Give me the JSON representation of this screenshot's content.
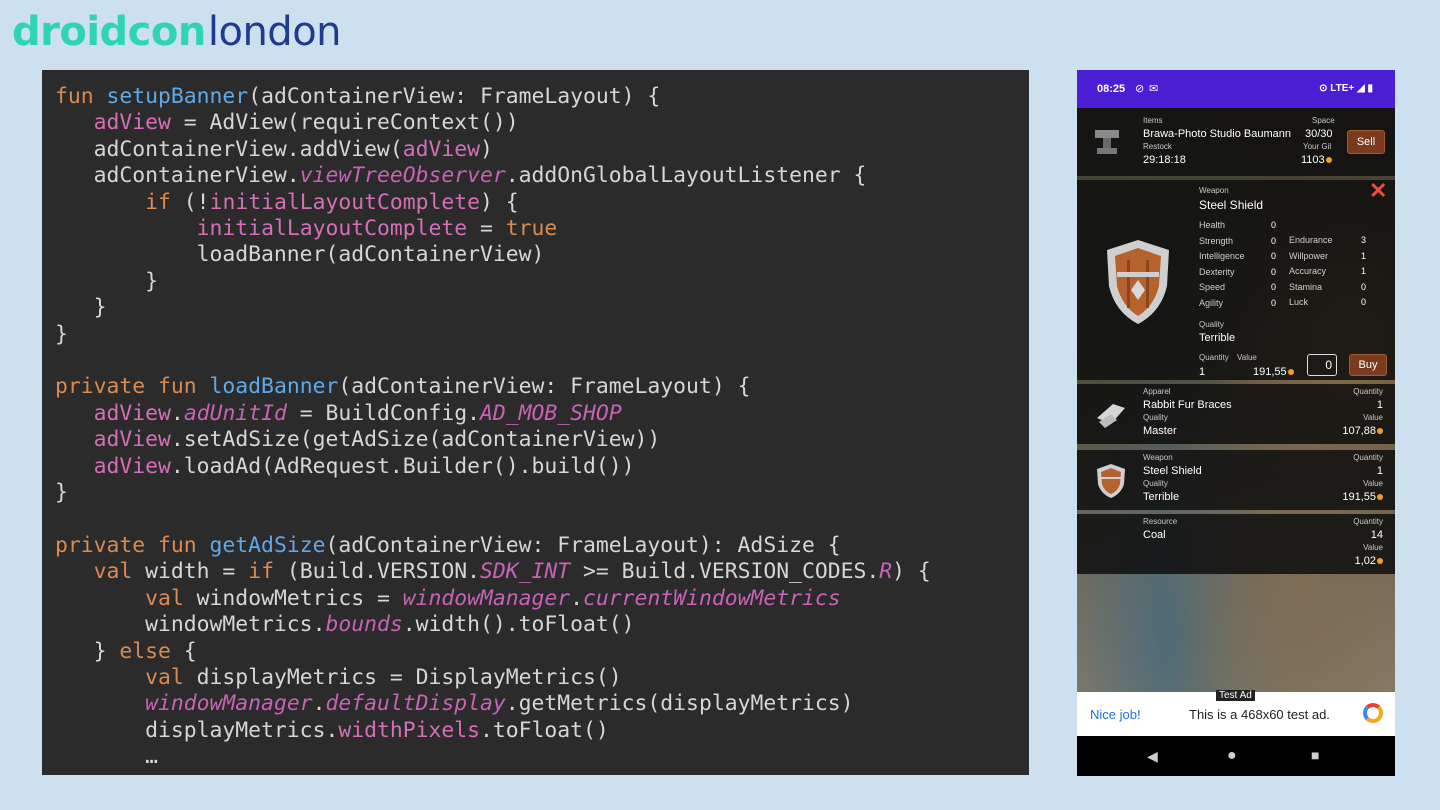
{
  "logo": {
    "part1": "droidcon",
    "part2": "london"
  },
  "code": {
    "lines": [
      [
        [
          "kw",
          "fun "
        ],
        [
          "fn",
          "setupBanner"
        ],
        [
          "",
          "(adContainerView: FrameLayout) {"
        ]
      ],
      [
        [
          "",
          "   "
        ],
        [
          "pr",
          "adView"
        ],
        [
          "",
          " = AdView(requireContext())"
        ]
      ],
      [
        [
          "",
          "   adContainerView.addView("
        ],
        [
          "pr",
          "adView"
        ],
        [
          "",
          ")"
        ]
      ],
      [
        [
          "",
          "   adContainerView."
        ],
        [
          "it",
          "viewTreeObserver"
        ],
        [
          "",
          ".addOnGlobalLayoutListener {"
        ]
      ],
      [
        [
          "",
          "       "
        ],
        [
          "kw",
          "if"
        ],
        [
          "",
          " (!"
        ],
        [
          "pr",
          "initialLayoutComplete"
        ],
        [
          "",
          ") {"
        ]
      ],
      [
        [
          "",
          "           "
        ],
        [
          "pr",
          "initialLayoutComplete"
        ],
        [
          "",
          " = "
        ],
        [
          "kw",
          "true"
        ]
      ],
      [
        [
          "",
          "           loadBanner(adContainerView)"
        ]
      ],
      [
        [
          "",
          "       }"
        ]
      ],
      [
        [
          "",
          "   }"
        ]
      ],
      [
        [
          "",
          "}"
        ]
      ],
      [
        [
          "",
          ""
        ]
      ],
      [
        [
          "kw",
          "private fun "
        ],
        [
          "fn",
          "loadBanner"
        ],
        [
          "",
          "(adContainerView: FrameLayout) {"
        ]
      ],
      [
        [
          "",
          "   "
        ],
        [
          "pr",
          "adView"
        ],
        [
          "",
          "."
        ],
        [
          "it",
          "adUnitId"
        ],
        [
          "",
          " = BuildConfig."
        ],
        [
          "it",
          "AD_MOB_SHOP"
        ]
      ],
      [
        [
          "",
          "   "
        ],
        [
          "pr",
          "adView"
        ],
        [
          "",
          ".setAdSize(getAdSize(adContainerView))"
        ]
      ],
      [
        [
          "",
          "   "
        ],
        [
          "pr",
          "adView"
        ],
        [
          "",
          ".loadAd(AdRequest.Builder().build())"
        ]
      ],
      [
        [
          "",
          "}"
        ]
      ],
      [
        [
          "",
          ""
        ]
      ],
      [
        [
          "kw",
          "private fun "
        ],
        [
          "fn",
          "getAdSize"
        ],
        [
          "",
          "(adContainerView: FrameLayout): AdSize {"
        ]
      ],
      [
        [
          "",
          "   "
        ],
        [
          "kw",
          "val"
        ],
        [
          "",
          " width = "
        ],
        [
          "kw",
          "if"
        ],
        [
          "",
          " (Build.VERSION."
        ],
        [
          "it",
          "SDK_INT"
        ],
        [
          "",
          " >= Build.VERSION_CODES."
        ],
        [
          "it",
          "R"
        ],
        [
          "",
          ") {"
        ]
      ],
      [
        [
          "",
          "       "
        ],
        [
          "kw",
          "val"
        ],
        [
          "",
          " windowMetrics = "
        ],
        [
          "it",
          "windowManager"
        ],
        [
          "",
          "."
        ],
        [
          "it",
          "currentWindowMetrics"
        ]
      ],
      [
        [
          "",
          "       windowMetrics."
        ],
        [
          "it",
          "bounds"
        ],
        [
          "",
          ".width().toFloat()"
        ]
      ],
      [
        [
          "",
          "   } "
        ],
        [
          "kw",
          "else"
        ],
        [
          "",
          " {"
        ]
      ],
      [
        [
          "",
          "       "
        ],
        [
          "kw",
          "val"
        ],
        [
          "",
          " displayMetrics = DisplayMetrics()"
        ]
      ],
      [
        [
          "",
          "       "
        ],
        [
          "it",
          "windowManager"
        ],
        [
          "",
          "."
        ],
        [
          "it",
          "defaultDisplay"
        ],
        [
          "",
          ".getMetrics(displayMetrics)"
        ]
      ],
      [
        [
          "",
          "       displayMetrics."
        ],
        [
          "pr",
          "widthPixels"
        ],
        [
          "",
          ".toFloat()"
        ]
      ],
      [
        [
          "",
          "       …"
        ]
      ]
    ]
  },
  "phone": {
    "status": {
      "time": "08:25",
      "network": "LTE+"
    },
    "shop": {
      "items_label": "Items",
      "name": "Brawa-Photo Studio Baumann",
      "space_label": "Space",
      "space": "30/30",
      "restock_label": "Restock",
      "restock": "29:18:18",
      "gil_label": "Your Gil",
      "gil": "1103",
      "sell": "Sell"
    },
    "detail": {
      "type_label": "Weapon",
      "name": "Steel Shield",
      "stats_left": [
        {
          "label": "Health",
          "value": "0"
        },
        {
          "label": "Strength",
          "value": "0"
        },
        {
          "label": "Intelligence",
          "value": "0"
        },
        {
          "label": "Dexterity",
          "value": "0"
        },
        {
          "label": "Speed",
          "value": "0"
        },
        {
          "label": "Agility",
          "value": "0"
        }
      ],
      "stats_right": [
        {
          "label": "Endurance",
          "value": "3"
        },
        {
          "label": "Willpower",
          "value": "1"
        },
        {
          "label": "Accuracy",
          "value": "1"
        },
        {
          "label": "Stamina",
          "value": "0"
        },
        {
          "label": "Luck",
          "value": "0"
        }
      ],
      "quality_label": "Quality",
      "quality": "Terrible",
      "quantity_label": "Quantity",
      "quantity": "1",
      "value_label": "Value",
      "value": "191,55",
      "qty_input": "0",
      "buy": "Buy"
    },
    "items": [
      {
        "type": "Apparel",
        "name": "Rabbit Fur Braces",
        "quality_label": "Quality",
        "quality": "Master",
        "quantity_label": "Quantity",
        "quantity": "1",
        "value_label": "Value",
        "value": "107,88"
      },
      {
        "type": "Weapon",
        "name": "Steel Shield",
        "quality_label": "Quality",
        "quality": "Terrible",
        "quantity_label": "Quantity",
        "quantity": "1",
        "value_label": "Value",
        "value": "191,55"
      },
      {
        "type": "Resource",
        "name": "Coal",
        "quality_label": "",
        "quality": "",
        "quantity_label": "Quantity",
        "quantity": "14",
        "value_label": "Value",
        "value": "1,02"
      }
    ],
    "ad": {
      "tag": "Test Ad",
      "nice": "Nice job!",
      "text": "This is a 468x60 test ad."
    },
    "nav": {
      "back": "◀",
      "home": "●",
      "recents": "■"
    }
  }
}
